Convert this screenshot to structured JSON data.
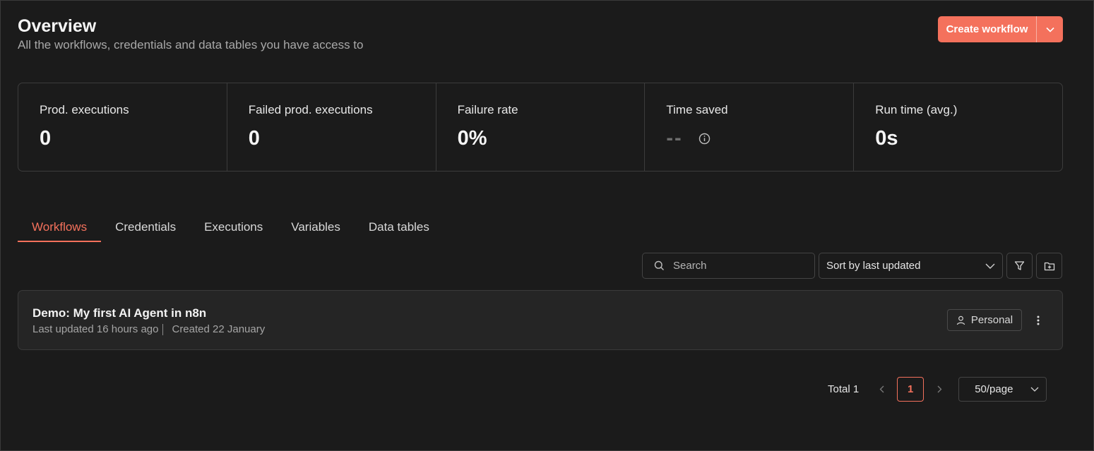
{
  "header": {
    "title": "Overview",
    "subtitle": "All the workflows, credentials and data tables you have access to",
    "create_button": "Create workflow"
  },
  "stats": [
    {
      "label": "Prod. executions",
      "value": "0"
    },
    {
      "label": "Failed prod. executions",
      "value": "0"
    },
    {
      "label": "Failure rate",
      "value": "0%"
    },
    {
      "label": "Time saved",
      "value": "--"
    },
    {
      "label": "Run time (avg.)",
      "value": "0s"
    }
  ],
  "tabs": [
    {
      "label": "Workflows",
      "active": true
    },
    {
      "label": "Credentials"
    },
    {
      "label": "Executions"
    },
    {
      "label": "Variables"
    },
    {
      "label": "Data tables"
    }
  ],
  "toolbar": {
    "search_placeholder": "Search",
    "sort_label": "Sort by last updated"
  },
  "workflows": [
    {
      "name": "Demo: My first AI Agent in n8n",
      "last_updated": "Last updated 16 hours ago",
      "created": "Created 22 January",
      "owner_badge": "Personal"
    }
  ],
  "pagination": {
    "total": "Total 1",
    "current_page": "1",
    "per_page": "50/page"
  },
  "colors": {
    "accent": "#f4715c",
    "background": "#1b1b1b",
    "card": "#252525"
  }
}
